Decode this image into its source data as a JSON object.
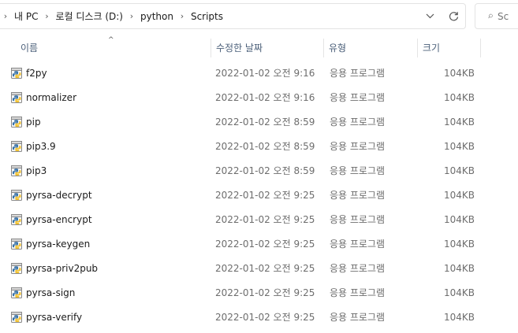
{
  "address_bar": {
    "crumbs": [
      "내 PC",
      "로컬 디스크 (D:)",
      "python",
      "Scripts"
    ],
    "dropdown_icon": "chevron-down-icon",
    "refresh_icon": "refresh-icon"
  },
  "search": {
    "placeholder": "Sc",
    "icon": "search-icon"
  },
  "columns": {
    "name": "이름",
    "date": "수정한 날짜",
    "type": "유형",
    "size": "크기"
  },
  "files": [
    {
      "name": "f2py",
      "date": "2022-01-02 오전 9:16",
      "type": "응용 프로그램",
      "size": "104KB"
    },
    {
      "name": "normalizer",
      "date": "2022-01-02 오전 9:16",
      "type": "응용 프로그램",
      "size": "104KB"
    },
    {
      "name": "pip",
      "date": "2022-01-02 오전 8:59",
      "type": "응용 프로그램",
      "size": "104KB"
    },
    {
      "name": "pip3.9",
      "date": "2022-01-02 오전 8:59",
      "type": "응용 프로그램",
      "size": "104KB"
    },
    {
      "name": "pip3",
      "date": "2022-01-02 오전 8:59",
      "type": "응용 프로그램",
      "size": "104KB"
    },
    {
      "name": "pyrsa-decrypt",
      "date": "2022-01-02 오전 9:25",
      "type": "응용 프로그램",
      "size": "104KB"
    },
    {
      "name": "pyrsa-encrypt",
      "date": "2022-01-02 오전 9:25",
      "type": "응용 프로그램",
      "size": "104KB"
    },
    {
      "name": "pyrsa-keygen",
      "date": "2022-01-02 오전 9:25",
      "type": "응용 프로그램",
      "size": "104KB"
    },
    {
      "name": "pyrsa-priv2pub",
      "date": "2022-01-02 오전 9:25",
      "type": "응용 프로그램",
      "size": "104KB"
    },
    {
      "name": "pyrsa-sign",
      "date": "2022-01-02 오전 9:25",
      "type": "응용 프로그램",
      "size": "104KB"
    },
    {
      "name": "pyrsa-verify",
      "date": "2022-01-02 오전 9:25",
      "type": "응용 프로그램",
      "size": "104KB"
    }
  ],
  "file_icon": "python-file-icon"
}
